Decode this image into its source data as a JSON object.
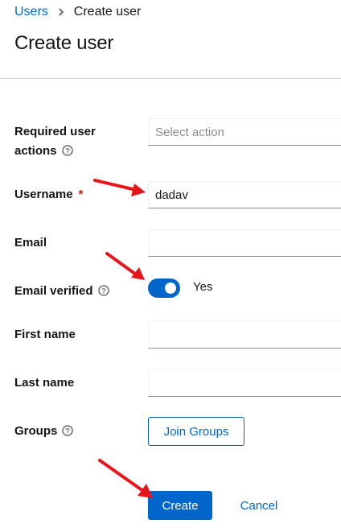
{
  "breadcrumb": {
    "parent": "Users",
    "current": "Create user"
  },
  "page_title": "Create user",
  "form": {
    "required_actions": {
      "label_line1": "Required user",
      "label_line2": "actions",
      "placeholder": "Select action"
    },
    "username": {
      "label": "Username",
      "required_mark": "*",
      "value": "dadav"
    },
    "email": {
      "label": "Email",
      "value": ""
    },
    "email_verified": {
      "label": "Email verified",
      "state_text": "Yes",
      "checked": true
    },
    "first_name": {
      "label": "First name",
      "value": ""
    },
    "last_name": {
      "label": "Last name",
      "value": ""
    },
    "groups": {
      "label": "Groups",
      "button_label": "Join Groups"
    }
  },
  "actions": {
    "create_label": "Create",
    "cancel_label": "Cancel"
  },
  "colors": {
    "primary": "#0066cc",
    "required": "#c9190b",
    "annotation_arrow": "#e8161b"
  },
  "icons": {
    "breadcrumb_separator": "chevron-right-icon",
    "help": "help-icon"
  }
}
